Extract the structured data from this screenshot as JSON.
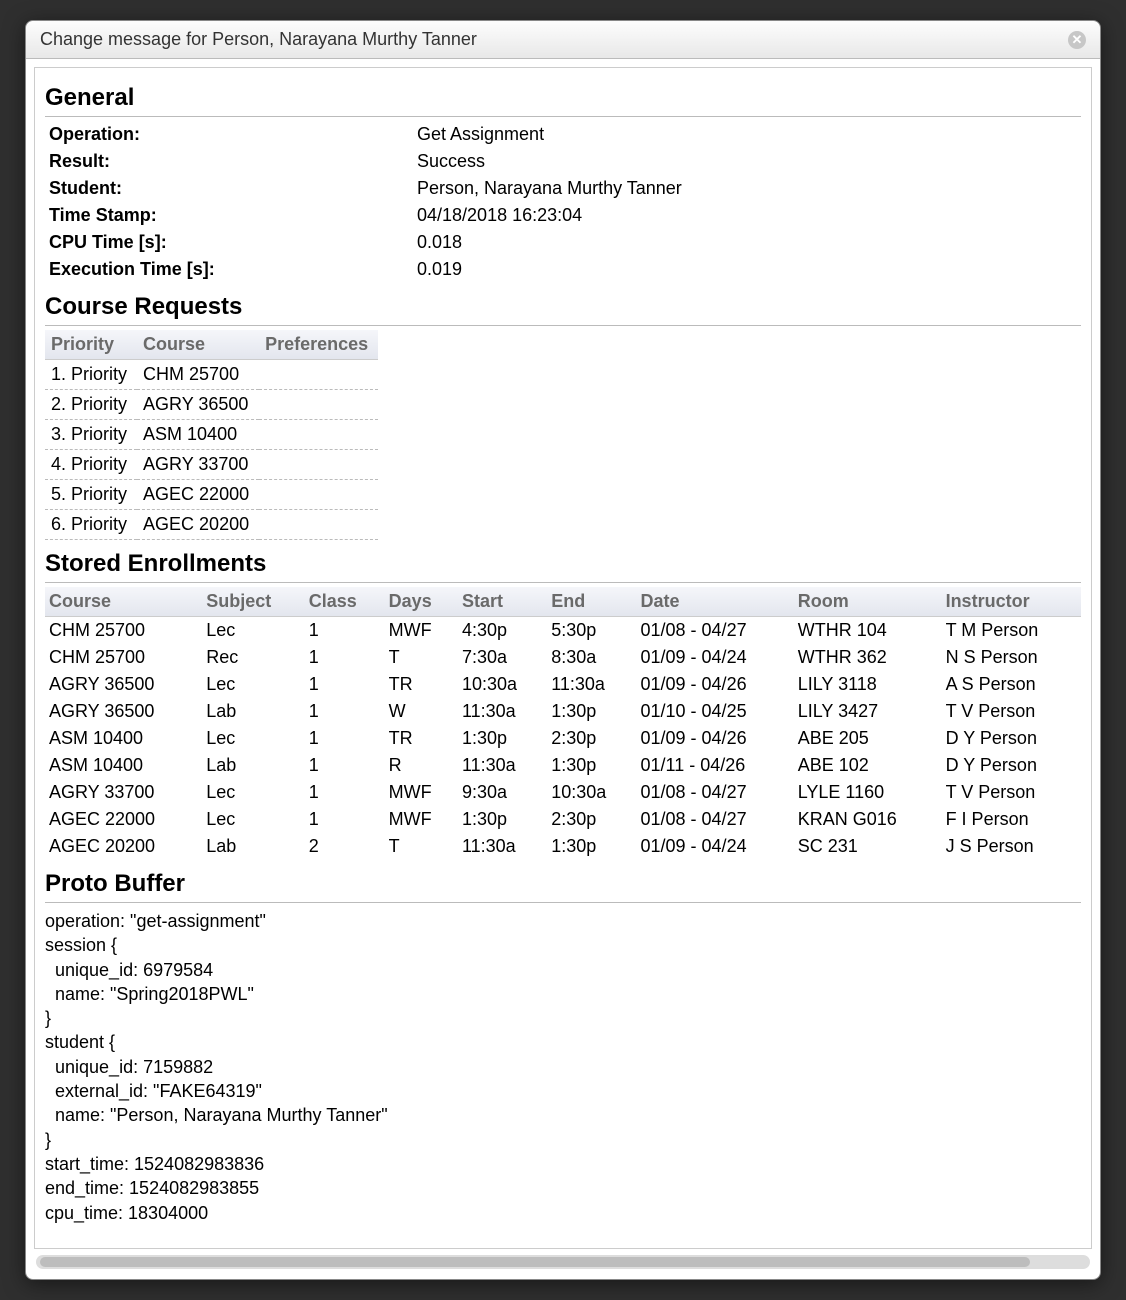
{
  "dialog": {
    "title": "Change message for Person, Narayana Murthy Tanner"
  },
  "sections": {
    "general": "General",
    "course_requests": "Course Requests",
    "stored_enrollments": "Stored Enrollments",
    "proto_buffer": "Proto Buffer"
  },
  "general": {
    "labels": {
      "operation": "Operation:",
      "result": "Result:",
      "student": "Student:",
      "time_stamp": "Time Stamp:",
      "cpu_time": "CPU Time [s]:",
      "exec_time": "Execution Time [s]:"
    },
    "values": {
      "operation": "Get Assignment",
      "result": "Success",
      "student": "Person, Narayana Murthy Tanner",
      "time_stamp": "04/18/2018 16:23:04",
      "cpu_time": "0.018",
      "exec_time": "0.019"
    }
  },
  "course_requests": {
    "headers": {
      "priority": "Priority",
      "course": "Course",
      "preferences": "Preferences"
    },
    "rows": [
      {
        "priority": "1. Priority",
        "course": "CHM 25700",
        "prefs": ""
      },
      {
        "priority": "2. Priority",
        "course": "AGRY 36500",
        "prefs": ""
      },
      {
        "priority": "3. Priority",
        "course": "ASM 10400",
        "prefs": ""
      },
      {
        "priority": "4. Priority",
        "course": "AGRY 33700",
        "prefs": ""
      },
      {
        "priority": "5. Priority",
        "course": "AGEC 22000",
        "prefs": ""
      },
      {
        "priority": "6. Priority",
        "course": "AGEC 20200",
        "prefs": ""
      }
    ]
  },
  "stored_enrollments": {
    "headers": {
      "course": "Course",
      "subject": "Subject",
      "class": "Class",
      "days": "Days",
      "start": "Start",
      "end": "End",
      "date": "Date",
      "room": "Room",
      "instructor": "Instructor"
    },
    "rows": [
      {
        "course": "CHM 25700",
        "subject": "Lec",
        "class": "1",
        "days": "MWF",
        "start": "4:30p",
        "end": "5:30p",
        "date": "01/08 - 04/27",
        "room": "WTHR 104",
        "instructor": "T M Person"
      },
      {
        "course": "CHM 25700",
        "subject": "Rec",
        "class": "1",
        "days": "T",
        "start": "7:30a",
        "end": "8:30a",
        "date": "01/09 - 04/24",
        "room": "WTHR 362",
        "instructor": "N S Person"
      },
      {
        "course": "AGRY 36500",
        "subject": "Lec",
        "class": "1",
        "days": "TR",
        "start": "10:30a",
        "end": "11:30a",
        "date": "01/09 - 04/26",
        "room": "LILY 3118",
        "instructor": "A S Person"
      },
      {
        "course": "AGRY 36500",
        "subject": "Lab",
        "class": "1",
        "days": "W",
        "start": "11:30a",
        "end": "1:30p",
        "date": "01/10 - 04/25",
        "room": "LILY 3427",
        "instructor": "T V Person"
      },
      {
        "course": "ASM 10400",
        "subject": "Lec",
        "class": "1",
        "days": "TR",
        "start": "1:30p",
        "end": "2:30p",
        "date": "01/09 - 04/26",
        "room": "ABE 205",
        "instructor": "D Y Person"
      },
      {
        "course": "ASM 10400",
        "subject": "Lab",
        "class": "1",
        "days": "R",
        "start": "11:30a",
        "end": "1:30p",
        "date": "01/11 - 04/26",
        "room": "ABE 102",
        "instructor": "D Y Person"
      },
      {
        "course": "AGRY 33700",
        "subject": "Lec",
        "class": "1",
        "days": "MWF",
        "start": "9:30a",
        "end": "10:30a",
        "date": "01/08 - 04/27",
        "room": "LYLE 1160",
        "instructor": "T V Person"
      },
      {
        "course": "AGEC 22000",
        "subject": "Lec",
        "class": "1",
        "days": "MWF",
        "start": "1:30p",
        "end": "2:30p",
        "date": "01/08 - 04/27",
        "room": "KRAN G016",
        "instructor": "F I Person"
      },
      {
        "course": "AGEC 20200",
        "subject": "Lab",
        "class": "2",
        "days": "T",
        "start": "11:30a",
        "end": "1:30p",
        "date": "01/09 - 04/24",
        "room": "SC 231",
        "instructor": "J S Person"
      }
    ]
  },
  "proto_buffer": "operation: \"get-assignment\"\nsession {\n  unique_id: 6979584\n  name: \"Spring2018PWL\"\n}\nstudent {\n  unique_id: 7159882\n  external_id: \"FAKE64319\"\n  name: \"Person, Narayana Murthy Tanner\"\n}\nstart_time: 1524082983836\nend_time: 1524082983855\ncpu_time: 18304000"
}
